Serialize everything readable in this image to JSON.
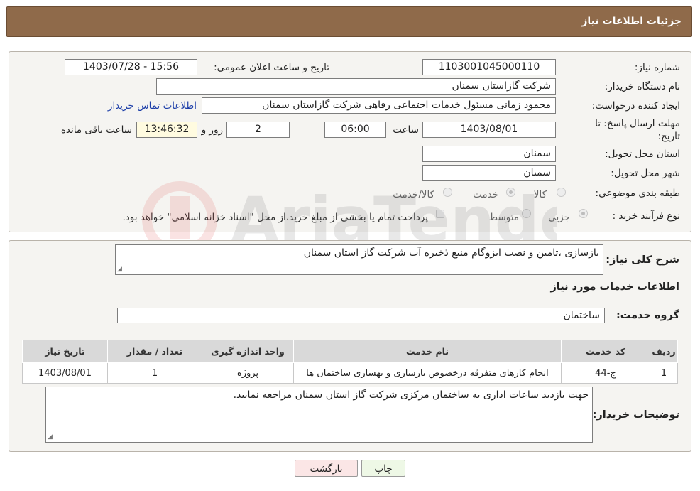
{
  "header": {
    "title": "جزئیات اطلاعات نیاز"
  },
  "form": {
    "need_number_label": "شماره نیاز:",
    "need_number": "1103001045000110",
    "announce_label": "تاریخ و ساعت اعلان عمومی:",
    "announce_value": "1403/07/28 - 15:56",
    "buyer_org_label": "نام دستگاه خریدار:",
    "buyer_org": "شرکت گازاستان سمنان",
    "creator_label": "ایجاد کننده درخواست:",
    "creator": "محمود زمانی مسئول خدمات اجتماعی رفاهی شرکت گازاستان سمنان",
    "contact_link": "اطلاعات تماس خریدار",
    "deadline_label_1": "مهلت ارسال پاسخ: تا",
    "deadline_label_2": "تاریخ:",
    "deadline_date": "1403/08/01",
    "time_label": "ساعت",
    "deadline_time": "06:00",
    "days": "2",
    "days_label": "روز و",
    "remaining_time": "13:46:32",
    "remaining_label": "ساعت باقی مانده",
    "province_label": "استان محل تحویل:",
    "province": "سمنان",
    "city_label": "شهر محل تحویل:",
    "city": "سمنان",
    "category_label": "طبقه بندی موضوعی:",
    "category_options": [
      "کالا",
      "خدمت",
      "کالا/خدمت"
    ],
    "category_selected": "خدمت",
    "process_label": "نوع فرآیند خرید :",
    "process_options": [
      "جزیی",
      "متوسط"
    ],
    "process_selected": "جزیی",
    "payment_note": "پرداخت تمام یا بخشی از مبلغ خرید،از محل \"اسناد خزانه اسلامی\" خواهد بود."
  },
  "details": {
    "summary_label": "شرح کلی نیاز:",
    "summary": "بازسازی ،تامین و نصب ایزوگام منبع ذخیره آب شرکت گاز استان سمنان",
    "services_title": "اطلاعات خدمات مورد نیاز",
    "service_group_label": "گروه خدمت:",
    "service_group": "ساختمان",
    "table": {
      "headers": [
        "ردیف",
        "کد خدمت",
        "نام خدمت",
        "واحد اندازه گیری",
        "تعداد / مقدار",
        "تاریخ نیاز"
      ],
      "rows": [
        [
          "1",
          "ج-44",
          "انجام کارهای متفرقه درخصوص بازسازی و بهسازی ساختمان ها",
          "پروژه",
          "1",
          "1403/08/01"
        ]
      ]
    },
    "buyer_notes_label": "توضیحات خریدار:",
    "buyer_notes": "جهت بازدید ساعات اداری به ساختمان مرکزی شرکت گاز استان سمنان مراجعه نمایید."
  },
  "buttons": {
    "print": "چاپ",
    "back": "بازگشت"
  },
  "watermark": {
    "text": "AriaTender.neT"
  },
  "colors": {
    "header_bg": "#8f6a4a",
    "link": "#1c3ea8",
    "print_bg": "#eef8e6",
    "back_bg": "#fbe6e6"
  }
}
